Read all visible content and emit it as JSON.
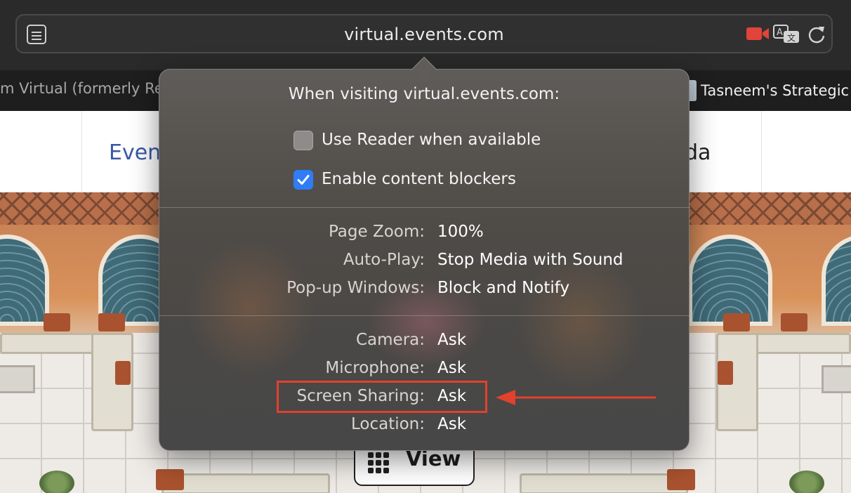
{
  "browser": {
    "url": "virtual.events.com",
    "toolbar_icons": [
      "sidebar-icon",
      "camera-icon",
      "translate-icon",
      "reload-icon"
    ],
    "camera_icon_color": "#e0443a"
  },
  "bookmarks": {
    "left_tab": "m Virtual (formerly Re",
    "right_tab": "Tasneem's Strategic"
  },
  "web_page": {
    "nav_left": "Even",
    "nav_right": "da",
    "view_button": "View"
  },
  "popover": {
    "title": "When visiting virtual.events.com:",
    "checkboxes": [
      {
        "label": "Use Reader when available",
        "checked": false
      },
      {
        "label": "Enable content blockers",
        "checked": true
      }
    ],
    "settings_group_1": [
      {
        "label": "Page Zoom:",
        "value": "100%"
      },
      {
        "label": "Auto-Play:",
        "value": "Stop Media with Sound"
      },
      {
        "label": "Pop-up Windows:",
        "value": "Block and Notify"
      }
    ],
    "settings_group_2": [
      {
        "label": "Camera:",
        "value": "Ask"
      },
      {
        "label": "Microphone:",
        "value": "Ask"
      },
      {
        "label": "Screen Sharing:",
        "value": "Ask"
      },
      {
        "label": "Location:",
        "value": "Ask"
      }
    ]
  },
  "annotation": {
    "highlighted_setting": "Screen Sharing:",
    "color": "#e1412d"
  }
}
